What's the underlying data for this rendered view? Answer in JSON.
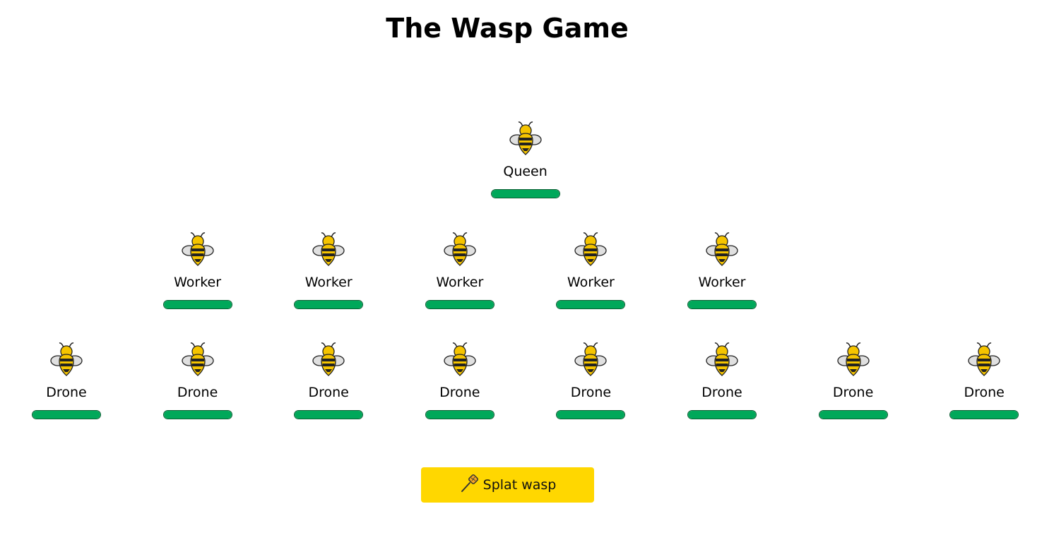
{
  "title": "The Wasp Game",
  "colors": {
    "health": "#00a85a",
    "button": "#ffd700",
    "wasp_body": "#f5c400",
    "wasp_wing": "#e0e0e0"
  },
  "queen": [
    {
      "type": "Queen",
      "health_fraction": 1.0
    }
  ],
  "workers": [
    {
      "type": "Worker",
      "health_fraction": 1.0
    },
    {
      "type": "Worker",
      "health_fraction": 1.0
    },
    {
      "type": "Worker",
      "health_fraction": 1.0
    },
    {
      "type": "Worker",
      "health_fraction": 1.0
    },
    {
      "type": "Worker",
      "health_fraction": 1.0
    }
  ],
  "drones": [
    {
      "type": "Drone",
      "health_fraction": 1.0
    },
    {
      "type": "Drone",
      "health_fraction": 1.0
    },
    {
      "type": "Drone",
      "health_fraction": 1.0
    },
    {
      "type": "Drone",
      "health_fraction": 1.0
    },
    {
      "type": "Drone",
      "health_fraction": 1.0
    },
    {
      "type": "Drone",
      "health_fraction": 1.0
    },
    {
      "type": "Drone",
      "health_fraction": 1.0
    },
    {
      "type": "Drone",
      "health_fraction": 1.0
    }
  ],
  "splat_button": {
    "label": "Splat wasp",
    "icon": "fly-swatter-icon"
  }
}
